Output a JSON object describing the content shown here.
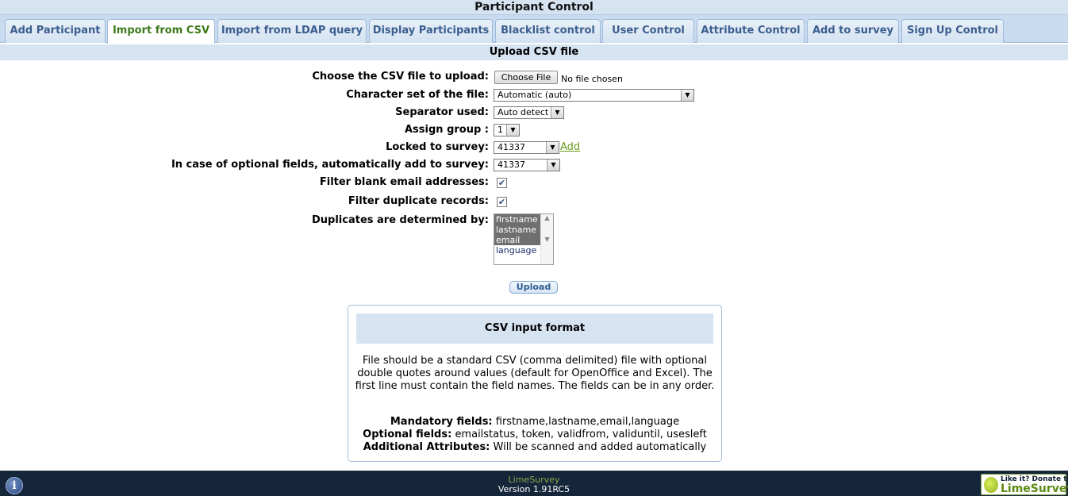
{
  "header": {
    "title": "Participant Control"
  },
  "tabs": [
    {
      "label": "Add Participant"
    },
    {
      "label": "Import from CSV",
      "active": true
    },
    {
      "label": "Import from LDAP query"
    },
    {
      "label": "Display Participants"
    },
    {
      "label": "Blacklist control"
    },
    {
      "label": "User Control"
    },
    {
      "label": "Attribute Control"
    },
    {
      "label": "Add to survey"
    },
    {
      "label": "Sign Up Control"
    }
  ],
  "section": {
    "title": "Upload CSV file"
  },
  "form": {
    "file_label": "Choose the CSV file to upload:",
    "file_button": "Choose File",
    "file_status": "No file chosen",
    "charset_label": "Character set of the file:",
    "charset_value": "Automatic (auto)",
    "separator_label": "Separator used:",
    "separator_value": "Auto detect",
    "group_label": "Assign group :",
    "group_value": "1",
    "locked_label": "Locked to survey:",
    "locked_value": "41337",
    "locked_add": "Add",
    "optional_label": "In case of optional fields, automatically add to survey:",
    "optional_value": "41337",
    "filter_blank_label": "Filter blank email addresses:",
    "filter_blank_checked": true,
    "filter_dup_label": "Filter duplicate records:",
    "filter_dup_checked": true,
    "duplicates_label": "Duplicates are determined by:",
    "duplicates_options": [
      {
        "label": "firstname",
        "selected": true
      },
      {
        "label": "lastname",
        "selected": true
      },
      {
        "label": "email",
        "selected": true
      },
      {
        "label": "language",
        "selected": false
      }
    ],
    "upload_button": "Upload"
  },
  "info": {
    "title": "CSV input format",
    "description": "File should be a standard CSV (comma delimited) file with optional double quotes around values (default for OpenOffice and Excel). The first line must contain the field names. The fields can be in any order.",
    "mandatory_label": "Mandatory fields:",
    "mandatory_value": "firstname,lastname,email,language",
    "optional_label": "Optional fields:",
    "optional_value": "emailstatus, token, validfrom, validuntil, usesleft",
    "additional_label": "Additional Attributes:",
    "additional_value": "Will be scanned and added automatically"
  },
  "footer": {
    "brand": "LimeSurvey",
    "version": "Version 1.91RC5",
    "donate_line1": "Like it? Donate to",
    "donate_line2": "LimeSurvey"
  }
}
